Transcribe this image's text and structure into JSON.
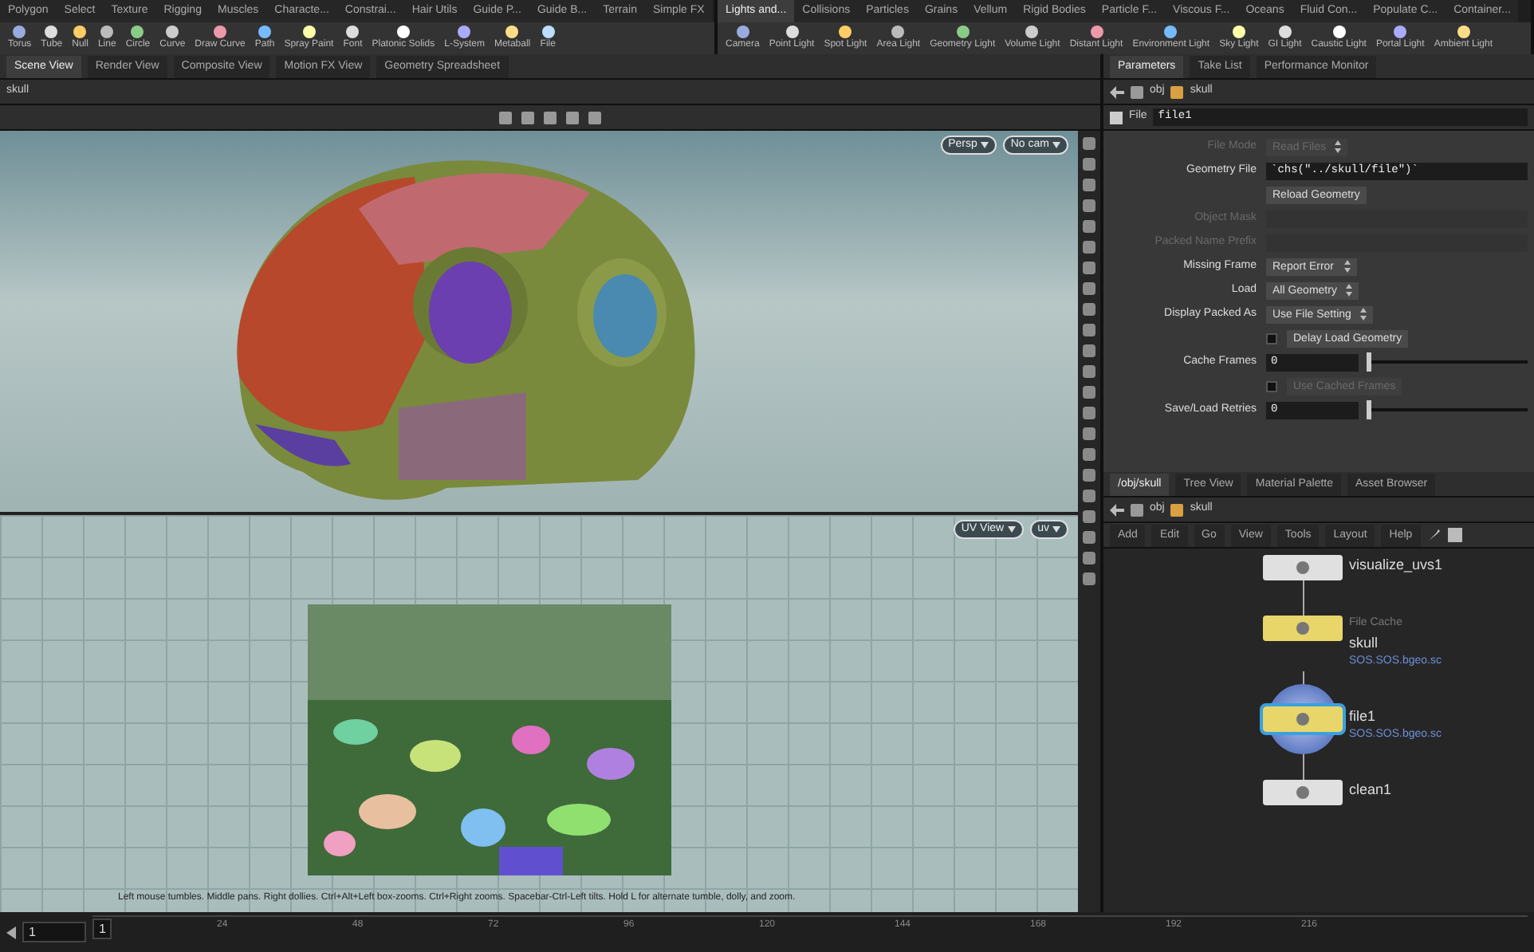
{
  "shelf_left": {
    "tabs": [
      {
        "label": "Polygon",
        "selected": false
      },
      {
        "label": "Select",
        "selected": false
      },
      {
        "label": "Texture",
        "selected": false
      },
      {
        "label": "Rigging",
        "selected": false
      },
      {
        "label": "Muscles",
        "selected": false
      },
      {
        "label": "Characte...",
        "selected": false
      },
      {
        "label": "Constrai...",
        "selected": false
      },
      {
        "label": "Hair Utils",
        "selected": false
      },
      {
        "label": "Guide P...",
        "selected": false
      },
      {
        "label": "Guide B...",
        "selected": false
      },
      {
        "label": "Terrain",
        "selected": false
      },
      {
        "label": "Simple FX",
        "selected": false
      }
    ],
    "tools": [
      "Torus",
      "Tube",
      "Null",
      "Line",
      "Circle",
      "Curve",
      "Draw Curve",
      "Path",
      "Spray Paint",
      "Font",
      "Platonic Solids",
      "L-System",
      "Metaball",
      "File"
    ]
  },
  "shelf_right": {
    "tabs": [
      {
        "label": "Lights and...",
        "selected": true
      },
      {
        "label": "Collisions",
        "selected": false
      },
      {
        "label": "Particles",
        "selected": false
      },
      {
        "label": "Grains",
        "selected": false
      },
      {
        "label": "Vellum",
        "selected": false
      },
      {
        "label": "Rigid Bodies",
        "selected": false
      },
      {
        "label": "Particle F...",
        "selected": false
      },
      {
        "label": "Viscous F...",
        "selected": false
      },
      {
        "label": "Oceans",
        "selected": false
      },
      {
        "label": "Fluid Con...",
        "selected": false
      },
      {
        "label": "Populate C...",
        "selected": false
      },
      {
        "label": "Container...",
        "selected": false
      }
    ],
    "tools": [
      "Camera",
      "Point Light",
      "Spot Light",
      "Area Light",
      "Geometry Light",
      "Volume Light",
      "Distant Light",
      "Environment Light",
      "Sky Light",
      "GI Light",
      "Caustic Light",
      "Portal Light",
      "Ambient Light"
    ]
  },
  "viewer": {
    "tabs": [
      {
        "label": "Scene View",
        "selected": true
      },
      {
        "label": "Render View",
        "selected": false
      },
      {
        "label": "Composite View",
        "selected": false
      },
      {
        "label": "Motion FX View",
        "selected": false
      },
      {
        "label": "Geometry Spreadsheet",
        "selected": false
      }
    ],
    "path": "skull",
    "camera_menus": [
      "Persp",
      "No cam"
    ],
    "uv_menus": [
      "UV View",
      "uv"
    ],
    "status": "Left mouse tumbles. Middle pans. Right dollies. Ctrl+Alt+Left box-zooms. Ctrl+Right zooms. Spacebar-Ctrl-Left tilts. Hold L for alternate tumble, dolly, and zoom."
  },
  "timeline": {
    "frame_field": "1",
    "current_frame": "1",
    "ticks": [
      "24",
      "48",
      "72",
      "96",
      "120",
      "144",
      "168",
      "192",
      "216"
    ]
  },
  "parameters": {
    "tabs": [
      {
        "label": "Parameters",
        "selected": true
      },
      {
        "label": "Take List",
        "selected": false
      },
      {
        "label": "Performance Monitor",
        "selected": false
      }
    ],
    "path": [
      "obj",
      "skull"
    ],
    "node_type": "File",
    "node_name": "file1",
    "rows": [
      {
        "kind": "menu",
        "label": "File Mode",
        "value": "Read Files",
        "disabled": true
      },
      {
        "kind": "text",
        "label": "Geometry File",
        "value": "`chs(\"../skull/file\")`",
        "disabled": false
      },
      {
        "kind": "button",
        "value": "Reload Geometry"
      },
      {
        "kind": "text",
        "label": "Object Mask",
        "value": "",
        "disabled": true
      },
      {
        "kind": "text",
        "label": "Packed Name Prefix",
        "value": "",
        "disabled": true
      },
      {
        "kind": "menu",
        "label": "Missing Frame",
        "value": "Report Error",
        "disabled": false
      },
      {
        "kind": "menu",
        "label": "Load",
        "value": "All Geometry",
        "disabled": false
      },
      {
        "kind": "menu",
        "label": "Display Packed As",
        "value": "Use File Setting",
        "disabled": false
      },
      {
        "kind": "checkbox",
        "value": "Delay Load Geometry",
        "checked": false,
        "disabled": false
      },
      {
        "kind": "slider",
        "label": "Cache Frames",
        "value": "0",
        "level": 0,
        "disabled": false
      },
      {
        "kind": "checkbox",
        "value": "Use Cached Frames",
        "checked": false,
        "disabled": true
      },
      {
        "kind": "slider",
        "label": "Save/Load Retries",
        "value": "0",
        "level": 0,
        "disabled": false
      }
    ]
  },
  "network": {
    "tabs": [
      {
        "label": "/obj/skull",
        "selected": true
      },
      {
        "label": "Tree View",
        "selected": false
      },
      {
        "label": "Material Palette",
        "selected": false
      },
      {
        "label": "Asset Browser",
        "selected": false
      }
    ],
    "path": [
      "obj",
      "skull"
    ],
    "menu": [
      "Add",
      "Edit",
      "Go",
      "View",
      "Tools",
      "Layout",
      "Help"
    ],
    "nodes": [
      {
        "name": "visualize_uvs1",
        "color": "#e0e0e0",
        "display": false
      },
      {
        "name": "skull",
        "color": "#e8d66a",
        "display": false,
        "caption": "File Cache",
        "link": "SOS.SOS.bgeo.sc"
      },
      {
        "name": "file1",
        "color": "#e8d66a",
        "display": true,
        "link": "SOS.SOS.bgeo.sc"
      },
      {
        "name": "clean1",
        "color": "#e0e0e0",
        "display": false
      }
    ]
  }
}
